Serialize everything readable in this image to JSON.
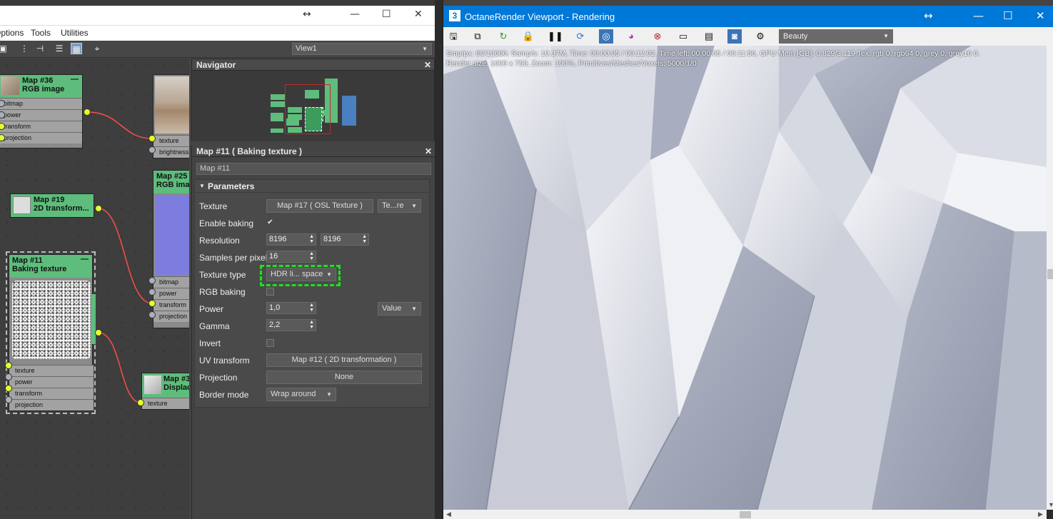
{
  "slate": {
    "title_strip_text": "",
    "menu": [
      "Options",
      "Tools",
      "Utilities"
    ],
    "view_select": "View1",
    "nodes": {
      "map36": {
        "title": "Map #36",
        "subtitle": "RGB image",
        "slots": [
          "bitmap",
          "power",
          "transform",
          "projection"
        ]
      },
      "map19": {
        "title": "Map #19",
        "subtitle": "2D transform..."
      },
      "map11": {
        "title": "Map #11",
        "subtitle": "Baking texture",
        "slots": [
          "texture",
          "power",
          "transform",
          "projection"
        ]
      },
      "map25": {
        "title": "Map #25",
        "subtitle": "RGB ima",
        "slots": [
          "bitmap",
          "power",
          "transform",
          "projection"
        ]
      },
      "top_right": {
        "slots": [
          "texture",
          "brightness"
        ]
      },
      "map3": {
        "title": "Map #3",
        "subtitle": "Displac",
        "slots": [
          "texture"
        ]
      }
    },
    "navigator": {
      "title": "Navigator"
    },
    "params": {
      "panel_title": "Map #11  ( Baking texture )",
      "map_name": "Map #11",
      "rollout_title": "Parameters",
      "texture_label": "Texture",
      "texture_value": "Map #17  ( OSL Texture )",
      "texture_mode": "Te...re",
      "enable_baking_label": "Enable baking",
      "enable_baking_check": "✔",
      "resolution_label": "Resolution",
      "resolution_x": "8196",
      "resolution_y": "8196",
      "samples_label": "Samples per pixel",
      "samples_value": "16",
      "texture_type_label": "Texture type",
      "texture_type_value": "HDR li... space",
      "rgb_baking_label": "RGB baking",
      "power_label": "Power",
      "power_value": "1,0",
      "power_mode": "Value",
      "gamma_label": "Gamma",
      "gamma_value": "2,2",
      "invert_label": "Invert",
      "uv_label": "UV transform",
      "uv_value": "Map #12  ( 2D transformation )",
      "projection_label": "Projection",
      "projection_value": "None",
      "border_label": "Border mode",
      "border_value": "Wrap around"
    }
  },
  "octane": {
    "title": "OctaneRender Viewport - Rendering",
    "pass_select": "Beauty",
    "stats_line1": "Smp/px: 80/10000,   Samp/s: 10.37M,   Time: 00:00:05 / 00:12:02,   Time left: 00:00:05 / 00:11:56,   GPU Mem [GB]: 0.829/3.119   Tex: rgb 0, rgb64 0, grey 0, grey16 0.",
    "stats_line2": "Render size: 1000 x 750,   Zoom: 100%,   Primitives/Meshes/Voxels: 5000/1/0"
  },
  "colors": {
    "node_header": "#5ebd7c",
    "socket_active": "#e3ff2d",
    "wire": "#ff4a4a",
    "highlight": "#1fe01f",
    "title_bar": "#0078d7"
  }
}
